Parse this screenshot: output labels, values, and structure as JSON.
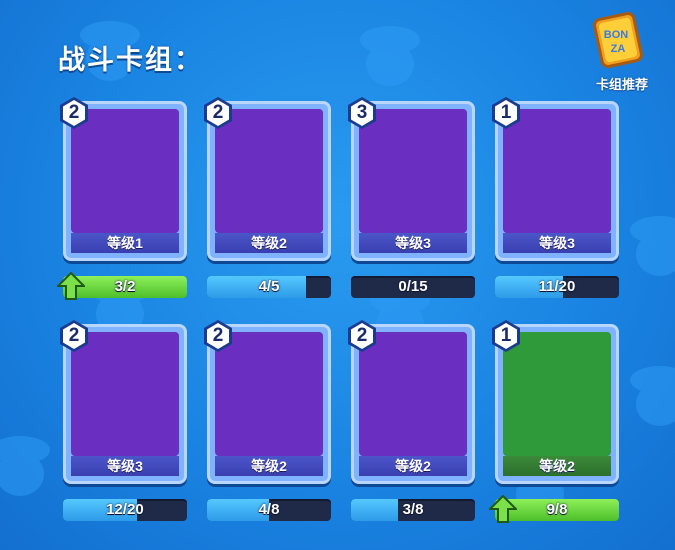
{
  "title": "战斗卡组：",
  "recommend": {
    "label": "卡组推荐",
    "badge_text_top": "BON",
    "badge_text_bottom": "ZA",
    "icon": "deck-recommend-badge-icon"
  },
  "colors": {
    "background": "#1a84e2",
    "progress_blue": "#2d9be8",
    "progress_green": "#4cbf2a",
    "level_bar": "#3a3fb0"
  },
  "cards": [
    {
      "cost": "2",
      "level": "等级1",
      "progress": "3/2",
      "fill": 1.0,
      "upgradable": true,
      "art": "dash-strike-icon",
      "theme": "purple"
    },
    {
      "cost": "2",
      "level": "等级2",
      "progress": "4/5",
      "fill": 0.8,
      "upgradable": false,
      "art": "whirlwind-icon",
      "theme": "purple"
    },
    {
      "cost": "3",
      "level": "等级3",
      "progress": "0/15",
      "fill": 0.0,
      "upgradable": false,
      "art": "cycle-arrows-icon",
      "theme": "purple"
    },
    {
      "cost": "1",
      "level": "等级3",
      "progress": "11/20",
      "fill": 0.55,
      "upgradable": false,
      "art": "eggplant-icon",
      "theme": "purple"
    },
    {
      "cost": "2",
      "level": "等级3",
      "progress": "12/20",
      "fill": 0.6,
      "upgradable": false,
      "art": "cactus-icon",
      "theme": "purple"
    },
    {
      "cost": "2",
      "level": "等级2",
      "progress": "4/8",
      "fill": 0.5,
      "upgradable": false,
      "art": "cucumber-icon",
      "theme": "purple"
    },
    {
      "cost": "2",
      "level": "等级2",
      "progress": "3/8",
      "fill": 0.375,
      "upgradable": false,
      "art": "bamboo-volley-icon",
      "theme": "purple"
    },
    {
      "cost": "1",
      "level": "等级2",
      "progress": "9/8",
      "fill": 1.0,
      "upgradable": true,
      "art": "heal-bubble-icon",
      "theme": "green"
    }
  ]
}
